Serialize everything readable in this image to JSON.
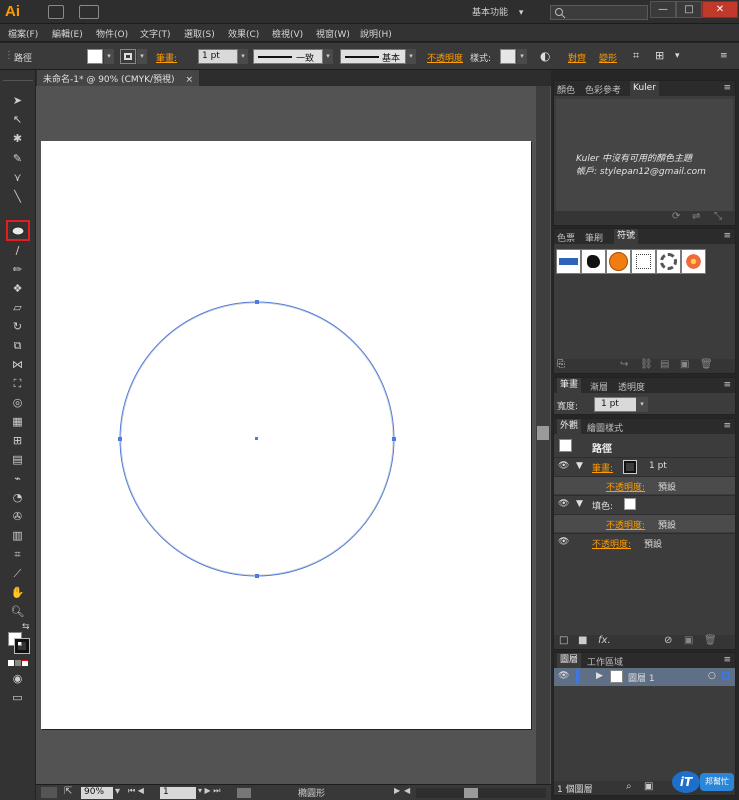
{
  "app": {
    "logo": "Ai",
    "workspace": "基本功能",
    "workspace_arrow": "▾",
    "window_buttons": [
      "—",
      "□",
      "✕"
    ]
  },
  "menu": [
    "檔案(F)",
    "編輯(E)",
    "物件(O)",
    "文字(T)",
    "選取(S)",
    "效果(C)",
    "檢視(V)",
    "視窗(W)",
    "說明(H)"
  ],
  "control": {
    "object_type": "路徑",
    "stroke_label": "筆畫:",
    "stroke_weight": "1 pt",
    "profile": "一致",
    "brush": "基本",
    "opacity_label": "不透明度",
    "style_label": "樣式:",
    "align_label": "對齊",
    "transform_label": "變形"
  },
  "document": {
    "tab_title": "未命名-1* @ 90% (CMYK/預視)",
    "tab_close": "×"
  },
  "status": {
    "zoom": "90%",
    "page": "1",
    "tool_name": "橢圓形"
  },
  "kuler": {
    "tabs": [
      "顏色",
      "色彩參考",
      "Kuler"
    ],
    "message_line1": "Kuler 中沒有可用的顏色主題",
    "message_line2": "帳戶: stylepan12@gmail.com"
  },
  "swatch_panel": {
    "tabs": [
      "色票",
      "筆刷",
      "符號"
    ]
  },
  "stroke_panel": {
    "tabs": [
      "筆畫",
      "漸層",
      "透明度"
    ],
    "width_label": "寬度:",
    "width_value": "1 pt"
  },
  "appearance": {
    "tabs": [
      "外觀",
      "繪圖樣式"
    ],
    "title": "路徑",
    "rows": [
      {
        "label": "筆畫:",
        "value": "1 pt"
      },
      {
        "label": "不透明度:",
        "value": "預設"
      },
      {
        "label": "填色:",
        "value": ""
      },
      {
        "label": "不透明度:",
        "value": "預設"
      },
      {
        "label": "不透明度:",
        "value": "預設"
      }
    ],
    "footer_fx": "fx."
  },
  "layers": {
    "tabs": [
      "圖層",
      "工作區域"
    ],
    "layer_name": "圖層 1",
    "count": "1 個圖層"
  },
  "watermark": {
    "text1": "iT",
    "text2": "邦幫忙"
  },
  "colors": {
    "accent_orange": "#ff9c00",
    "selection_blue": "#4f7bdc",
    "panel_bg": "#3c3c3c",
    "highlight_red": "#e21e1e"
  }
}
